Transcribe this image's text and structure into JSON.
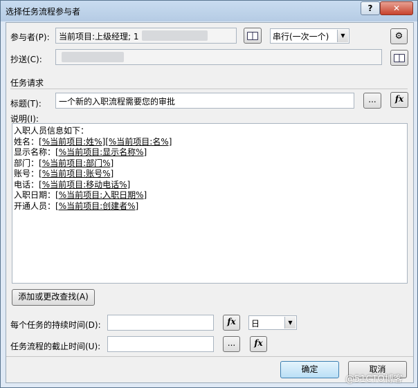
{
  "window": {
    "title": "选择任务流程参与者",
    "help": "?",
    "close": "✕"
  },
  "participants": {
    "label": "参与者(P):",
    "value": "当前项目:上级经理; 1",
    "order": "串行(一次一个)"
  },
  "cc": {
    "label": "抄送(C):"
  },
  "section_request": "任务请求",
  "subject": {
    "label": "标题(T):",
    "value": "一个新的入职流程需要您的审批",
    "browse": "...",
    "fx": "fx"
  },
  "description": {
    "label": "说明(I):",
    "header": "入职人员信息如下：",
    "lines": [
      {
        "key": "姓名：",
        "val": "[%当前项目:姓%][%当前项目:名%]"
      },
      {
        "key": "显示名称：",
        "val": "[%当前项目:显示名称%]"
      },
      {
        "key": "部门：",
        "val": "[%当前项目:部门%]"
      },
      {
        "key": "账号：",
        "val": "[%当前项目:账号%]"
      },
      {
        "key": "电话：",
        "val": "[%当前项目:移动电话%]"
      },
      {
        "key": "入职日期：",
        "val": "[%当前项目:入职日期%]"
      },
      {
        "key": "开通人员：",
        "val": "[%当前项目:创建者%]"
      }
    ]
  },
  "lookup_button": "添加或更改查找(A)",
  "duration": {
    "label": "每个任务的持续时间(D):",
    "value": "",
    "fx": "fx",
    "unit": "日"
  },
  "due": {
    "label": "任务流程的截止时间(U):",
    "value": "",
    "browse": "...",
    "fx": "fx"
  },
  "buttons": {
    "ok": "确定",
    "cancel": "取消"
  },
  "watermark": "@51CTO博客"
}
